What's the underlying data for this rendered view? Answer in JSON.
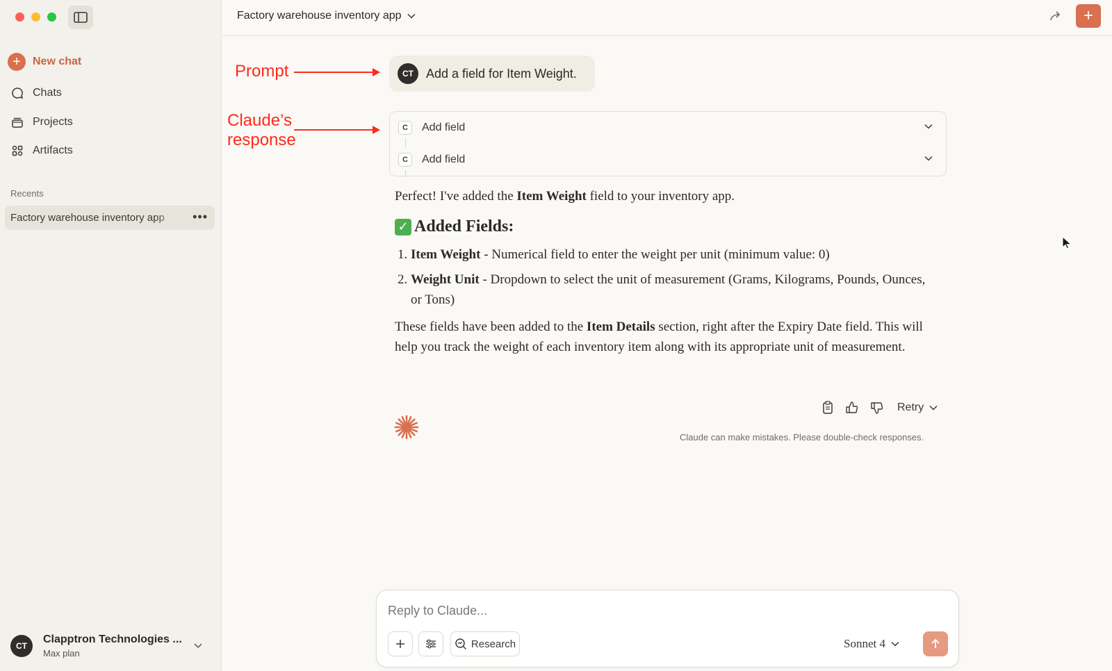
{
  "sidebar": {
    "new_chat": "New chat",
    "nav": [
      {
        "label": "Chats",
        "icon": "chat-bubble-icon"
      },
      {
        "label": "Projects",
        "icon": "folder-stack-icon"
      },
      {
        "label": "Artifacts",
        "icon": "grid-shapes-icon"
      }
    ],
    "recents_label": "Recents",
    "recents": [
      {
        "label": "Factory warehouse inventory app"
      }
    ],
    "account": {
      "initials": "CT",
      "name": "Clapptron Technologies ...",
      "plan": "Max plan"
    }
  },
  "header": {
    "title": "Factory warehouse inventory app"
  },
  "annotations": {
    "prompt": "Prompt",
    "response_line1": "Claude’s",
    "response_line2": "response",
    "color": "#ff2a1a"
  },
  "prompt": {
    "initials": "CT",
    "text": "Add a field for Item Weight."
  },
  "tools": [
    {
      "badge": "C",
      "label": "Add field"
    },
    {
      "badge": "C",
      "label": "Add field"
    }
  ],
  "response": {
    "intro_pre": "Perfect! I've added the ",
    "intro_bold": "Item Weight",
    "intro_post": " field to your inventory app.",
    "heading": "Added Fields:",
    "items": [
      {
        "num": "1.",
        "bold": "Item Weight",
        "text": " - Numerical field to enter the weight per unit (minimum value: 0)"
      },
      {
        "num": "2.",
        "bold": "Weight Unit",
        "text": " - Dropdown to select the unit of measurement (Grams, Kilograms, Pounds, Ounces, or Tons)"
      }
    ],
    "closing_pre": "These fields have been added to the ",
    "closing_bold": "Item Details",
    "closing_post": " section, right after the Expiry Date field. This will help you track the weight of each inventory item along with its appropriate unit of measurement."
  },
  "actions": {
    "retry": "Retry",
    "disclaimer": "Claude can make mistakes. Please double-check responses."
  },
  "composer": {
    "placeholder": "Reply to Claude...",
    "research": "Research",
    "model": "Sonnet 4"
  },
  "colors": {
    "accent": "#d9704f",
    "brand_text": "#c96442"
  }
}
